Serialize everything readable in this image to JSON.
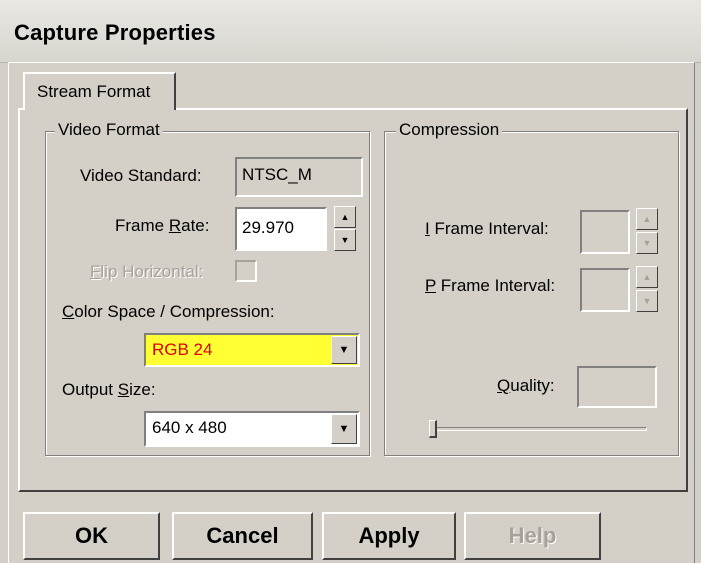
{
  "window": {
    "title": "Capture Properties"
  },
  "tabs": [
    {
      "label": "Stream Format"
    }
  ],
  "video_format": {
    "group_label": "Video Format",
    "video_standard_label": "Video Standard:",
    "video_standard_value": "NTSC_M",
    "frame_rate_label_pre": "Frame ",
    "frame_rate_label_key": "R",
    "frame_rate_label_post": "ate:",
    "frame_rate_value": "29.970",
    "flip_label_key": "F",
    "flip_label_post": "lip Horizontal:",
    "color_space_label_key": "C",
    "color_space_label_post": "olor Space / Compression:",
    "color_space_value": "RGB 24",
    "output_size_label_pre": "Output ",
    "output_size_label_key": "S",
    "output_size_label_post": "ize:",
    "output_size_value": "640 x 480"
  },
  "compression": {
    "group_label": "Compression",
    "i_frame_label_key": "I",
    "i_frame_label_post": " Frame Interval:",
    "i_frame_value": "",
    "p_frame_label_key": "P",
    "p_frame_label_post": " Frame Interval:",
    "p_frame_value": "",
    "quality_label_key": "Q",
    "quality_label_post": "uality:",
    "quality_value": "",
    "quality_level": 0
  },
  "buttons": {
    "ok": "OK",
    "cancel": "Cancel",
    "apply": "Apply",
    "help": "Help"
  },
  "colors": {
    "highlight_bg": "#ffff33",
    "highlight_text": "#e00000",
    "dialog_bg": "#d4d0c8"
  }
}
